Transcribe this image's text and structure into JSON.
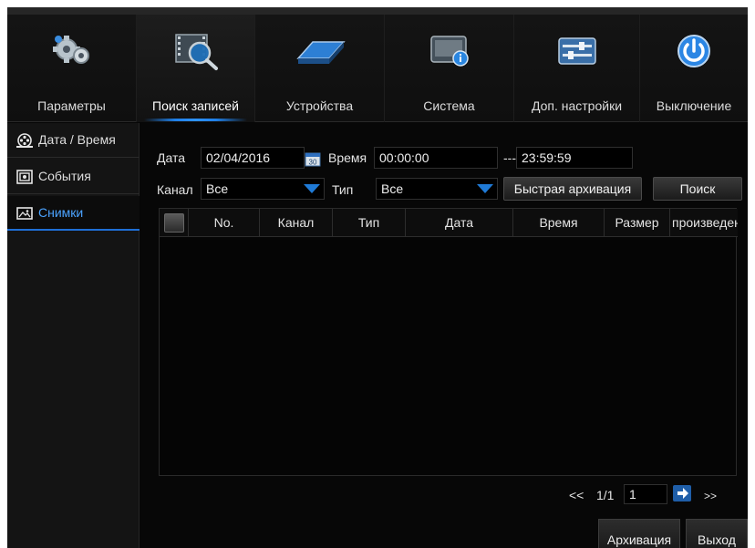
{
  "nav": {
    "items": [
      {
        "label": "Параметры",
        "icon": "gears-icon"
      },
      {
        "label": "Поиск записей",
        "icon": "film-search-icon"
      },
      {
        "label": "Устройства",
        "icon": "hdd-device-icon"
      },
      {
        "label": "Система",
        "icon": "system-info-icon"
      },
      {
        "label": "Доп. настройки",
        "icon": "advanced-settings-icon"
      },
      {
        "label": "Выключение",
        "icon": "power-icon"
      }
    ],
    "active_index": 1
  },
  "sidebar": {
    "items": [
      {
        "label": "Дата / Время",
        "icon": "film-reel-icon"
      },
      {
        "label": "События",
        "icon": "event-icon"
      },
      {
        "label": "Снимки",
        "icon": "picture-icon"
      }
    ],
    "active_index": 2
  },
  "filters": {
    "date_label": "Дата",
    "date_value": "02/04/2016",
    "calendar_day": "30",
    "time_label": "Время",
    "time_start": "00:00:00",
    "time_separator": "---",
    "time_end": "23:59:59",
    "channel_label": "Канал",
    "channel_value": "Все",
    "type_label": "Тип",
    "type_value": "Все",
    "quick_backup_label": "Быстрая архивация",
    "search_label": "Поиск"
  },
  "table": {
    "columns": [
      "No.",
      "Канал",
      "Тип",
      "Дата",
      "Время",
      "Размер",
      "произведение"
    ],
    "rows": []
  },
  "pager": {
    "prev": "<<",
    "page_info": "1/1",
    "page_input": "1",
    "next": ">>"
  },
  "footer": {
    "backup_label": "Архивация",
    "exit_label": "Выход"
  },
  "colors": {
    "accent": "#1f7fe6",
    "active_text": "#4ba3ff",
    "background": "#060606"
  }
}
